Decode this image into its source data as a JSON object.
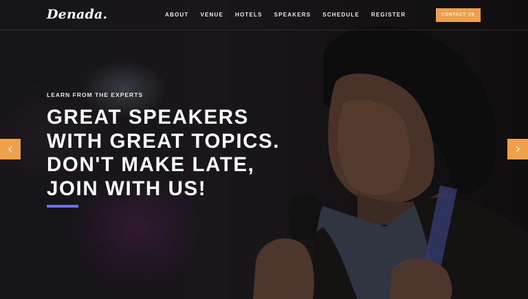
{
  "brand": {
    "logo_text": "Denada."
  },
  "nav": {
    "items": [
      {
        "label": "ABOUT"
      },
      {
        "label": "VENUE"
      },
      {
        "label": "HOTELS"
      },
      {
        "label": "SPEAKERS"
      },
      {
        "label": "SCHEDULE"
      },
      {
        "label": "REGISTER"
      }
    ],
    "contact_label": "CONTACT US"
  },
  "hero": {
    "kicker": "LEARN FROM THE EXPERTS",
    "headline_lines": [
      "GREAT SPEAKERS",
      "WITH GREAT TOPICS.",
      "DON'T MAKE LATE,",
      "JOIN WITH US!"
    ]
  },
  "slider": {
    "prev_icon": "chevron-left-icon",
    "next_icon": "chevron-right-icon"
  },
  "colors": {
    "accent_orange": "#f0a04b",
    "accent_blue": "#6a6ff0",
    "background": "#141414"
  }
}
